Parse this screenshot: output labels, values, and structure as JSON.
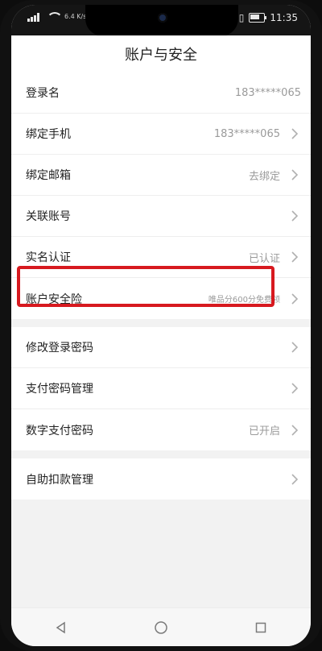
{
  "status": {
    "network_speed": "6.4\nK/s",
    "time": "11:35"
  },
  "header": {
    "title": "账户与安全"
  },
  "groups": [
    {
      "items": [
        {
          "label": "登录名",
          "value": "183*****065",
          "has_chevron": false
        },
        {
          "label": "绑定手机",
          "value": "183*****065",
          "has_chevron": true
        },
        {
          "label": "绑定邮箱",
          "value": "去绑定",
          "has_chevron": true
        },
        {
          "label": "关联账号",
          "value": "",
          "has_chevron": true
        },
        {
          "label": "实名认证",
          "value": "已认证",
          "has_chevron": true
        },
        {
          "label": "账户安全险",
          "value": "唯品分600分免费领",
          "has_chevron": true
        }
      ]
    },
    {
      "items": [
        {
          "label": "修改登录密码",
          "value": "",
          "has_chevron": true
        },
        {
          "label": "支付密码管理",
          "value": "",
          "has_chevron": true
        },
        {
          "label": "数字支付密码",
          "value": "已开启",
          "has_chevron": true
        }
      ]
    },
    {
      "items": [
        {
          "label": "自助扣款管理",
          "value": "",
          "has_chevron": true
        }
      ]
    }
  ],
  "colors": {
    "highlight": "#d7191f",
    "background": "#f2f2f2"
  },
  "icons": {
    "chevron": "chevron-right-icon",
    "back": "back-triangle-icon",
    "home": "home-circle-icon",
    "recent": "recent-square-icon"
  }
}
